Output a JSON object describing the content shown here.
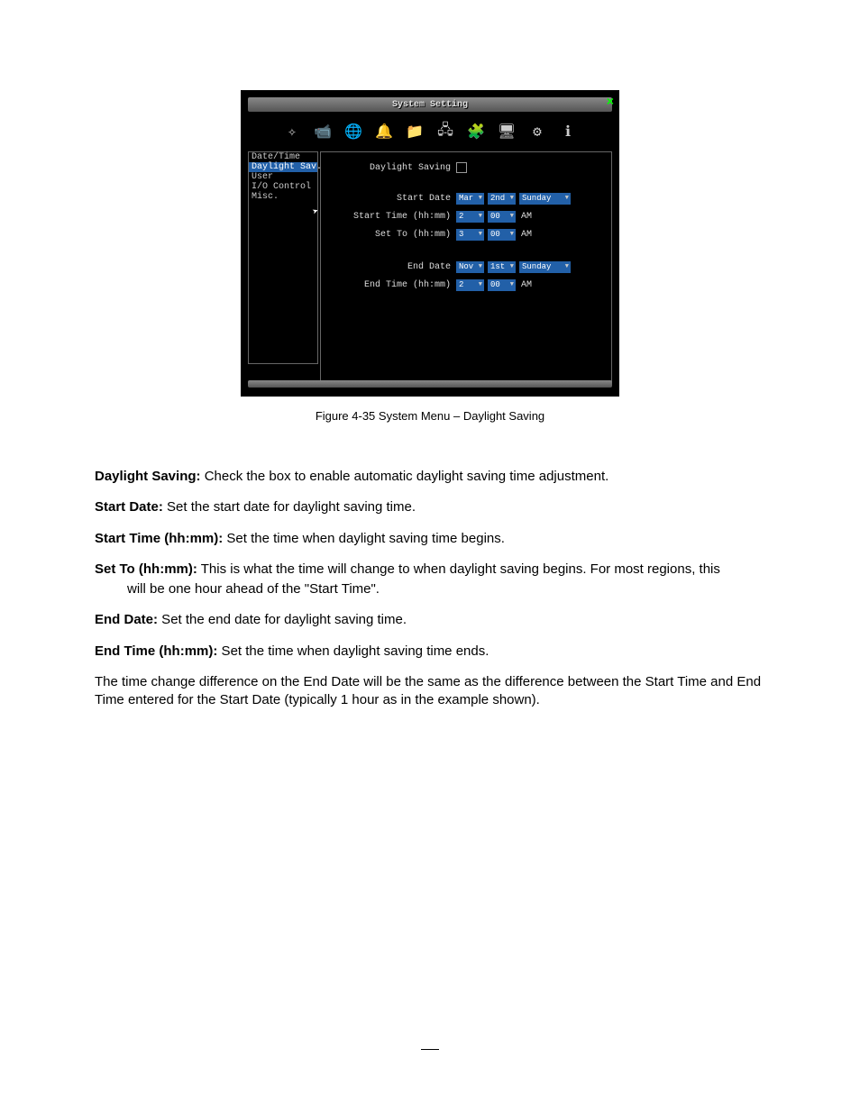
{
  "window": {
    "title": "System Setting",
    "close": "×"
  },
  "toolbar": {
    "icons": [
      "✧",
      "📹",
      "🌐",
      "🔔",
      "📁",
      "🖧",
      "🧩",
      "🖥",
      "⚙",
      "ℹ"
    ]
  },
  "sidebar": {
    "items": [
      {
        "label": "Date/Time",
        "selected": false
      },
      {
        "label": "Daylight Sav.",
        "selected": true
      },
      {
        "label": "User",
        "selected": false
      },
      {
        "label": "I/O Control",
        "selected": false
      },
      {
        "label": "Misc.",
        "selected": false
      }
    ]
  },
  "form": {
    "daylight_saving_label": "Daylight Saving",
    "start_date": {
      "label": "Start Date",
      "month": "Mar",
      "week": "2nd",
      "day": "Sunday"
    },
    "start_time": {
      "label": "Start Time (hh:mm)",
      "hh": "2",
      "mm": "00",
      "ampm": "AM"
    },
    "set_to": {
      "label": "Set To (hh:mm)",
      "hh": "3",
      "mm": "00",
      "ampm": "AM"
    },
    "end_date": {
      "label": "End Date",
      "month": "Nov",
      "week": "1st",
      "day": "Sunday"
    },
    "end_time": {
      "label": "End Time (hh:mm)",
      "hh": "2",
      "mm": "00",
      "ampm": "AM"
    }
  },
  "caption": "Figure 4-35   System Menu – Daylight Saving",
  "defs": {
    "d1_b": "Daylight Saving:",
    "d1_t": " Check the box to enable automatic daylight saving time adjustment.",
    "d2_b": "Start Date:",
    "d2_t": " Set the start date for daylight saving time.",
    "d3_b": "Start Time (hh:mm):",
    "d3_t": " Set the time when daylight saving time begins.",
    "d4_b": "Set To (hh:mm):",
    "d4_t": " This is what the time will change to when daylight saving begins. For most regions, this will be one hour ahead of the \"Start Time\".",
    "d5_b": "End Date:",
    "d5_t": " Set the end date for daylight saving time.",
    "d6_b": "End Time (hh:mm):",
    "d6_t": " Set the time when daylight saving time ends.",
    "d7": "The time change difference on the End Date will be the same as the difference between the Start Time and End Time entered for the Start Date (typically 1 hour as in the example shown)."
  }
}
